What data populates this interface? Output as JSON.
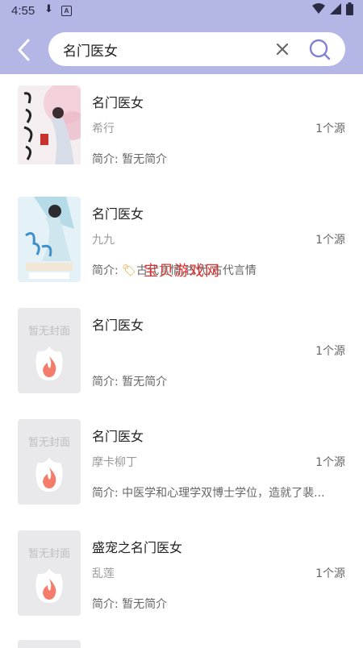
{
  "status_bar": {
    "time": "4:55"
  },
  "search": {
    "value": "名门医女"
  },
  "intro_prefix": "简介: ",
  "placeholder_cover_text": "暂无封面",
  "results": [
    {
      "title": "名门医女",
      "author": "希行",
      "sources": "1个源",
      "intro": "暂无简介",
      "cover": "image"
    },
    {
      "title": "名门医女",
      "author": "九九",
      "sources": "1个源",
      "intro": "古代言情,古代,古代言情",
      "cover": "image"
    },
    {
      "title": "名门医女",
      "author": "",
      "sources": "1个源",
      "intro": "暂无简介",
      "cover": "placeholder"
    },
    {
      "title": "名门医女",
      "author": "摩卡柳丁",
      "sources": "1个源",
      "intro": "中医学和心理学双博士学位，造就了裴...",
      "cover": "placeholder"
    },
    {
      "title": "盛宠之名门医女",
      "author": "乱莲",
      "sources": "1个源",
      "intro": "暂无简介",
      "cover": "placeholder"
    }
  ],
  "watermark": "宝贝游戏网",
  "colors": {
    "header_bg": "#b4b6e6",
    "accent": "#7f82d0",
    "placeholder_bg": "#e9e9ec",
    "flame": "#f47c6b"
  }
}
